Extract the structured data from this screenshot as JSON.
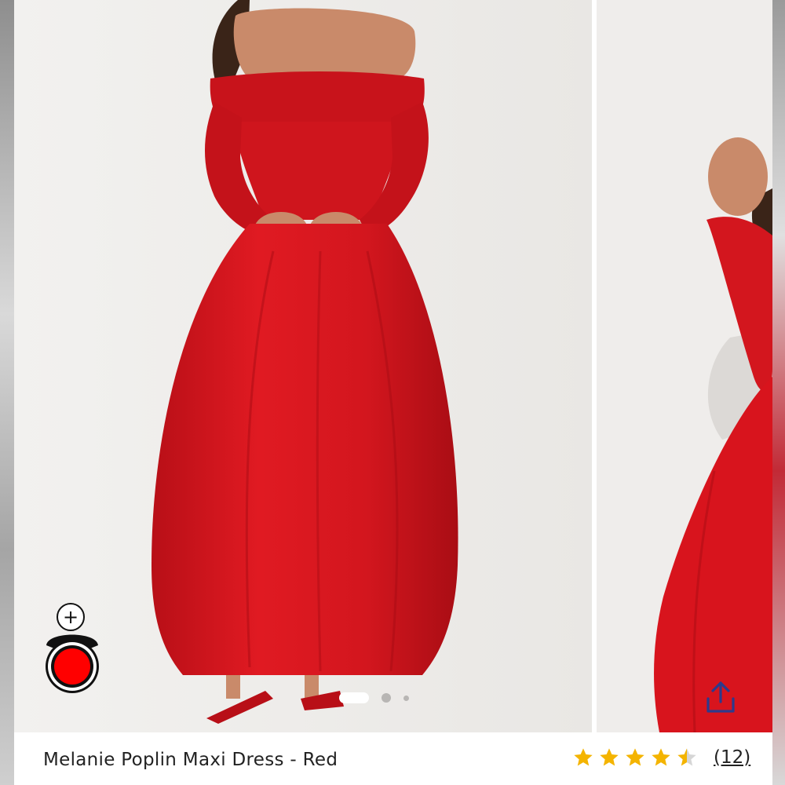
{
  "product": {
    "title": "Melanie Poplin Maxi Dress - Red",
    "rating": 4.5,
    "rating_max": 5,
    "review_count": "(12)"
  },
  "gallery": {
    "active_index": 0,
    "image_count": 3
  },
  "icons": {
    "share": "share-icon",
    "add": "plus-icon",
    "avatar": "avatar-icon",
    "star": "star-icon"
  },
  "colors": {
    "dress": "#d8141d",
    "star": "#f4b400",
    "star_empty": "#d6d6d6",
    "share": "#2d3a8c",
    "record": "#ff0000"
  }
}
